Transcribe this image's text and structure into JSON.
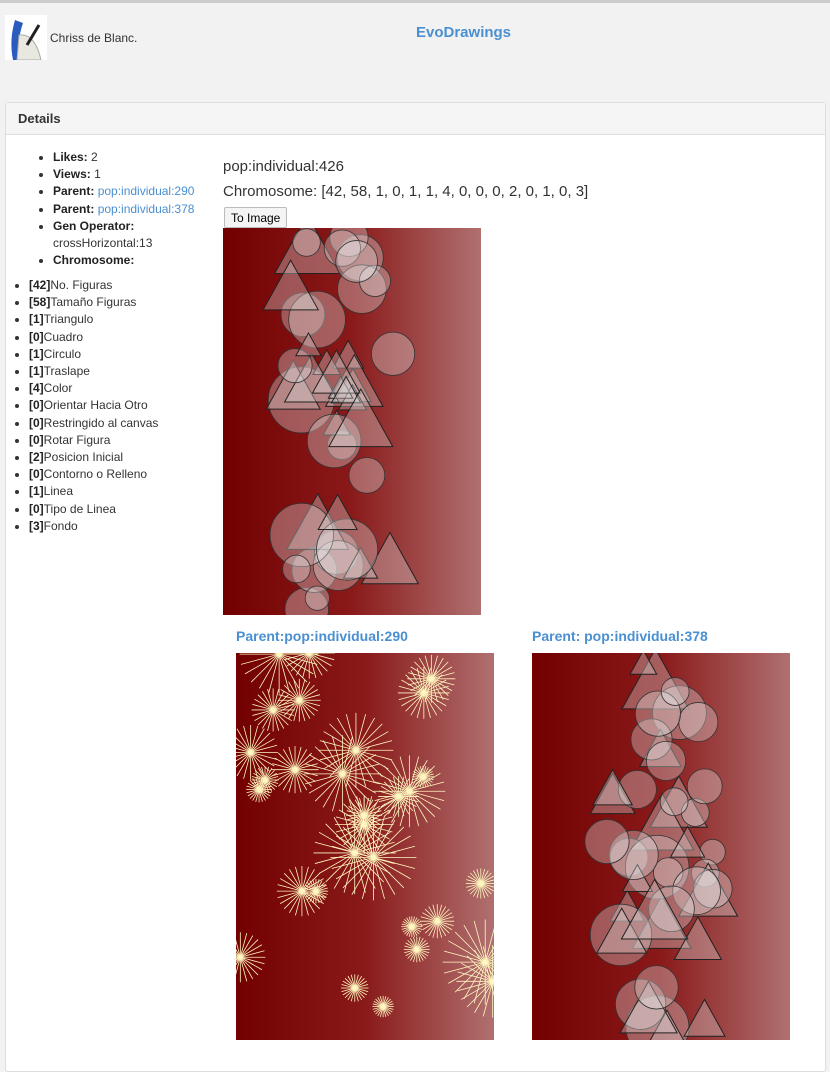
{
  "header": {
    "user_name": "Chriss de Blanc.",
    "brand": "EvoDrawings"
  },
  "panel": {
    "heading": "Details"
  },
  "details": {
    "likes_label": "Likes:",
    "likes": "2",
    "views_label": "Views:",
    "views": "1",
    "parent_label": "Parent:",
    "parent1": "pop:individual:290",
    "parent2": "pop:individual:378",
    "gen_operator_label": "Gen Operator:",
    "gen_operator": "crossHorizontal:13",
    "chromosome_label": "Chromosome:"
  },
  "chromosome_genes": [
    {
      "value": "[42]",
      "name": "No. Figuras"
    },
    {
      "value": "[58]",
      "name": "Tamaño Figuras"
    },
    {
      "value": "[1]",
      "name": "Triangulo"
    },
    {
      "value": "[0]",
      "name": "Cuadro"
    },
    {
      "value": "[1]",
      "name": "Circulo"
    },
    {
      "value": "[1]",
      "name": "Traslape"
    },
    {
      "value": "[4]",
      "name": "Color"
    },
    {
      "value": "[0]",
      "name": "Orientar Hacia Otro"
    },
    {
      "value": "[0]",
      "name": "Restringido al canvas"
    },
    {
      "value": "[0]",
      "name": "Rotar Figura"
    },
    {
      "value": "[2]",
      "name": "Posicion Inicial"
    },
    {
      "value": "[0]",
      "name": "Contorno o Relleno"
    },
    {
      "value": "[1]",
      "name": "Linea"
    },
    {
      "value": "[0]",
      "name": "Tipo de Linea"
    },
    {
      "value": "[3]",
      "name": "Fondo"
    }
  ],
  "main": {
    "title": "pop:individual:426",
    "chromosome": "Chromosome: [42, 58, 1, 0, 1, 1, 4, 0, 0, 0, 2, 0, 1, 0, 3]",
    "to_image_button": "To Image",
    "parent1_title": "Parent:pop:individual:290",
    "parent2_title": "Parent: pop:individual:378"
  },
  "colors": {
    "link": "#4a8fd0",
    "canvas_dark": "#720000",
    "canvas_light": "#b07070",
    "burst": "#fff8c0"
  }
}
